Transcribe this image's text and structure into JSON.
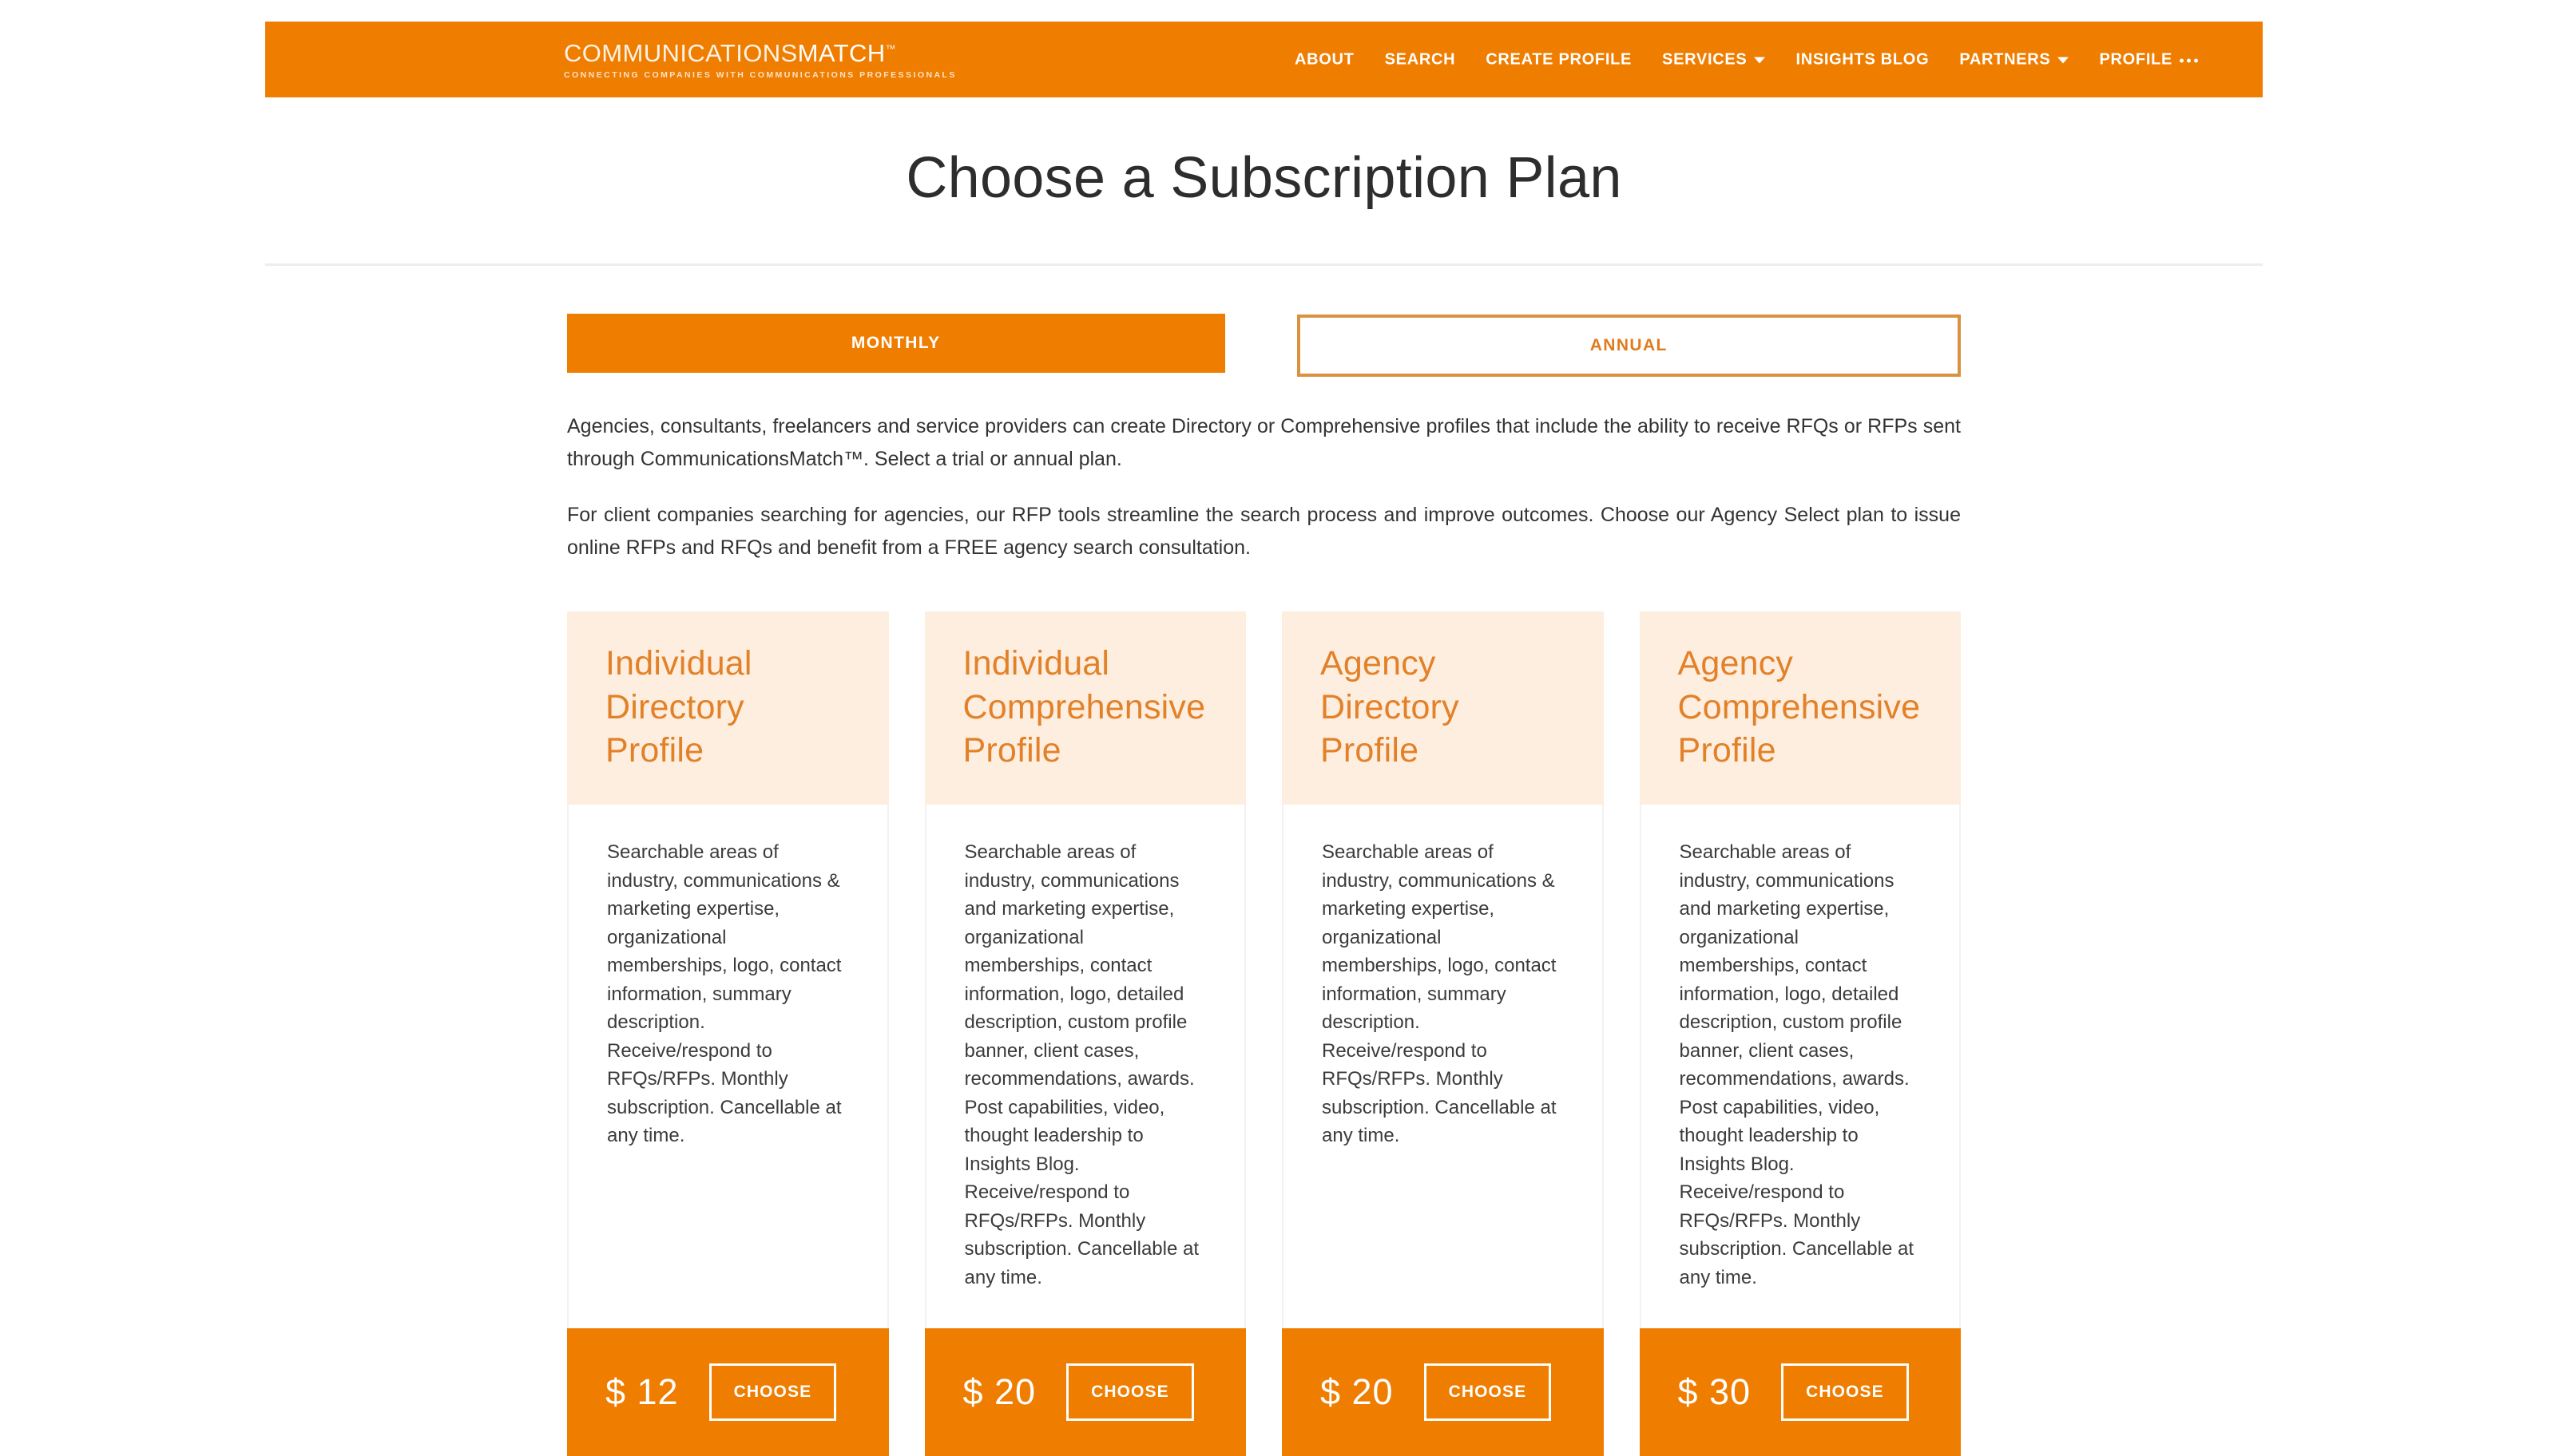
{
  "header": {
    "brand": {
      "name_part1": "COMMUNICATIONS",
      "name_part2": "MATCH",
      "tm": "™",
      "tagline": "CONNECTING COMPANIES WITH COMMUNICATIONS PROFESSIONALS"
    },
    "nav": [
      {
        "label": "ABOUT",
        "icon": "none"
      },
      {
        "label": "SEARCH",
        "icon": "none"
      },
      {
        "label": "CREATE PROFILE",
        "icon": "none"
      },
      {
        "label": "SERVICES",
        "icon": "chevron-down-icon"
      },
      {
        "label": "INSIGHTS BLOG",
        "icon": "none"
      },
      {
        "label": "PARTNERS",
        "icon": "chevron-down-icon"
      },
      {
        "label": "PROFILE",
        "icon": "ellipsis-icon"
      }
    ],
    "bar_color": "#EF7D00"
  },
  "page_title": "Choose a Subscription Plan",
  "billing_toggle": {
    "monthly_label": "MONTHLY",
    "annual_label": "ANNUAL",
    "selected": "MONTHLY",
    "active_bg": "#EF7D00",
    "inactive_border": "#D99240",
    "inactive_text": "#E07B1E"
  },
  "intro": {
    "paragraph_1": "Agencies, consultants, freelancers and service providers can create Directory or Comprehensive profiles that include the ability to receive RFQs or RFPs sent through CommunicationsMatch™. Select a trial or annual plan.",
    "paragraph_2": "For client companies searching for agencies, our RFP tools streamline the search process and improve outcomes. Choose our Agency Select plan to issue online RFPs and RFQs and benefit from a FREE agency search consultation."
  },
  "plans": [
    {
      "name": "Individual Directory Profile",
      "description": "Searchable areas of industry, communications & marketing expertise, organizational memberships, logo, contact information, summary description. Receive/respond to RFQs/RFPs. Monthly subscription. Cancellable at any time.",
      "price": "$ 12",
      "cta": "CHOOSE"
    },
    {
      "name": "Individual Comprehensive Profile",
      "description": "Searchable areas of industry, communications and marketing expertise, organizational memberships, contact information, logo, detailed description, custom profile banner, client cases, recommendations, awards. Post capabilities, video, thought leadership to Insights Blog. Receive/respond to RFQs/RFPs. Monthly subscription. Cancellable at any time.",
      "price": "$ 20",
      "cta": "CHOOSE"
    },
    {
      "name": "Agency Directory Profile",
      "description": "Searchable areas of industry, communications & marketing expertise, organizational memberships, logo, contact information, summary description. Receive/respond to RFQs/RFPs. Monthly subscription. Cancellable at any time.",
      "price": "$ 20",
      "cta": "CHOOSE"
    },
    {
      "name": "Agency Comprehensive Profile",
      "description": "Searchable areas of industry, communications and marketing expertise, organizational memberships, contact information, logo, detailed description, custom profile banner, client cases, recommendations, awards. Post capabilities, video, thought leadership to Insights Blog. Receive/respond to RFQs/RFPs. Monthly subscription. Cancellable at any time.",
      "price": "$ 30",
      "cta": "CHOOSE"
    }
  ],
  "theme": {
    "accent_orange": "#EF7D00",
    "card_header_bg": "#FDEEE0",
    "plan_name_color": "#E38128",
    "divider_color": "#EDEDED"
  }
}
